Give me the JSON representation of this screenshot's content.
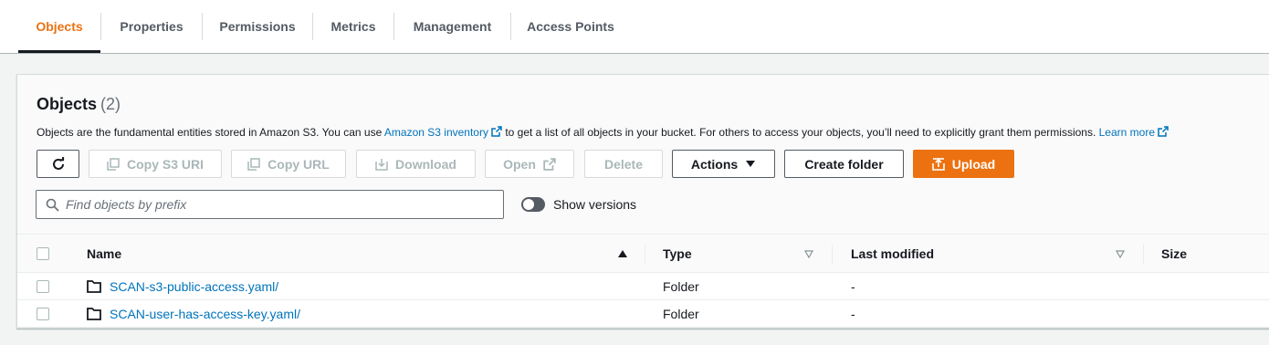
{
  "tabs": [
    {
      "label": "Objects",
      "active": true
    },
    {
      "label": "Properties",
      "active": false
    },
    {
      "label": "Permissions",
      "active": false
    },
    {
      "label": "Metrics",
      "active": false
    },
    {
      "label": "Management",
      "active": false
    },
    {
      "label": "Access Points",
      "active": false
    }
  ],
  "panel": {
    "title": "Objects",
    "count": "(2)",
    "description": {
      "part1": "Objects are the fundamental entities stored in Amazon S3. You can use ",
      "link1": "Amazon S3 inventory",
      "part2": " to get a list of all objects in your bucket. For others to access your objects, you’ll need to explicitly grant them permissions. ",
      "link2": "Learn more"
    }
  },
  "toolbar": {
    "copy_s3_uri": "Copy S3 URI",
    "copy_url": "Copy URL",
    "download": "Download",
    "open": "Open",
    "delete": "Delete",
    "actions": "Actions",
    "create_folder": "Create folder",
    "upload": "Upload"
  },
  "search": {
    "placeholder": "Find objects by prefix",
    "value": ""
  },
  "versions_toggle": {
    "label": "Show versions",
    "on": false
  },
  "table": {
    "columns": [
      "Name",
      "Type",
      "Last modified",
      "Size"
    ],
    "rows": [
      {
        "name": "SCAN-s3-public-access.yaml/",
        "type": "Folder",
        "last_modified": "-",
        "size": ""
      },
      {
        "name": "SCAN-user-has-access-key.yaml/",
        "type": "Folder",
        "last_modified": "-",
        "size": ""
      }
    ]
  },
  "colors": {
    "accent": "#ec7211",
    "link": "#0073bb",
    "text": "#16191f",
    "muted": "#545b64"
  },
  "icons": [
    "refresh-icon",
    "copy-icon",
    "download-icon",
    "external-link-icon",
    "caret-down-icon",
    "upload-icon",
    "search-icon",
    "folder-icon",
    "sort-ascending-icon",
    "sort-descending-icon"
  ]
}
